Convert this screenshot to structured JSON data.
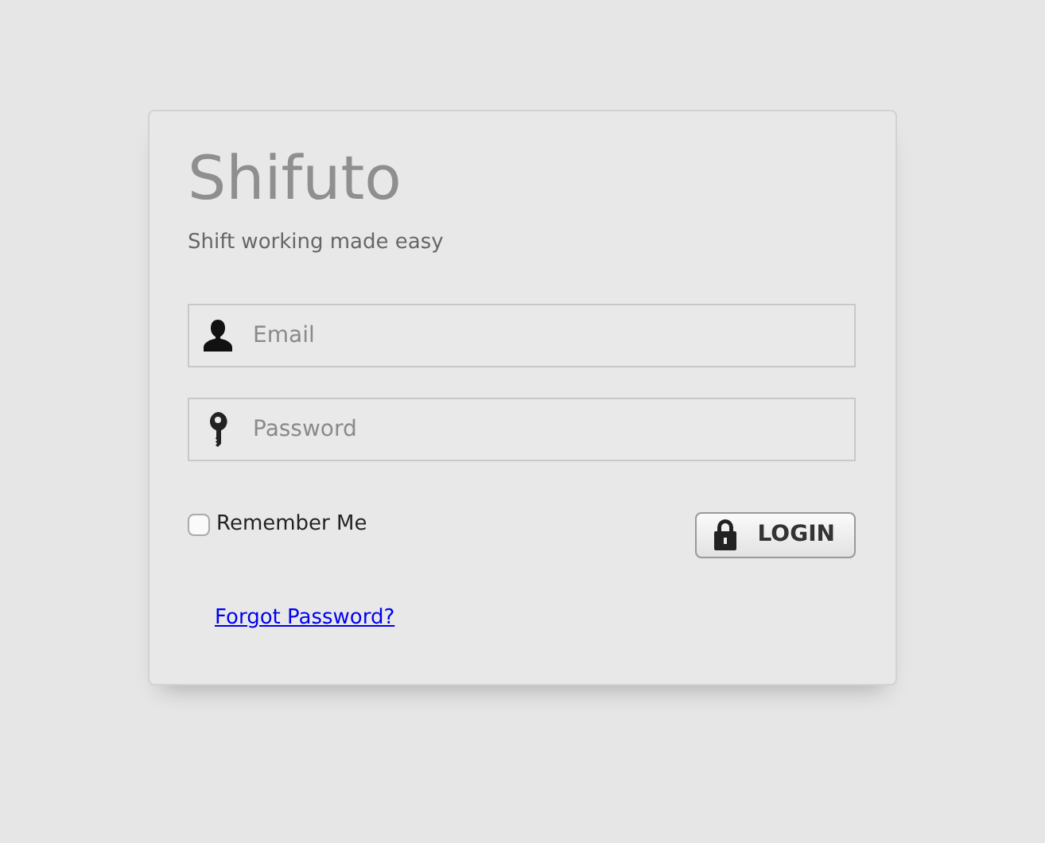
{
  "brand": {
    "title": "Shifuto",
    "tagline": "Shift working made easy"
  },
  "fields": [
    {
      "kind": "email",
      "placeholder": "Email"
    },
    {
      "kind": "password",
      "placeholder": "Password"
    }
  ],
  "remember": {
    "label": "Remember Me",
    "checked": false
  },
  "login_button": {
    "label": "LOGIN"
  },
  "forgot_link": {
    "label": "Forgot Password?"
  }
}
